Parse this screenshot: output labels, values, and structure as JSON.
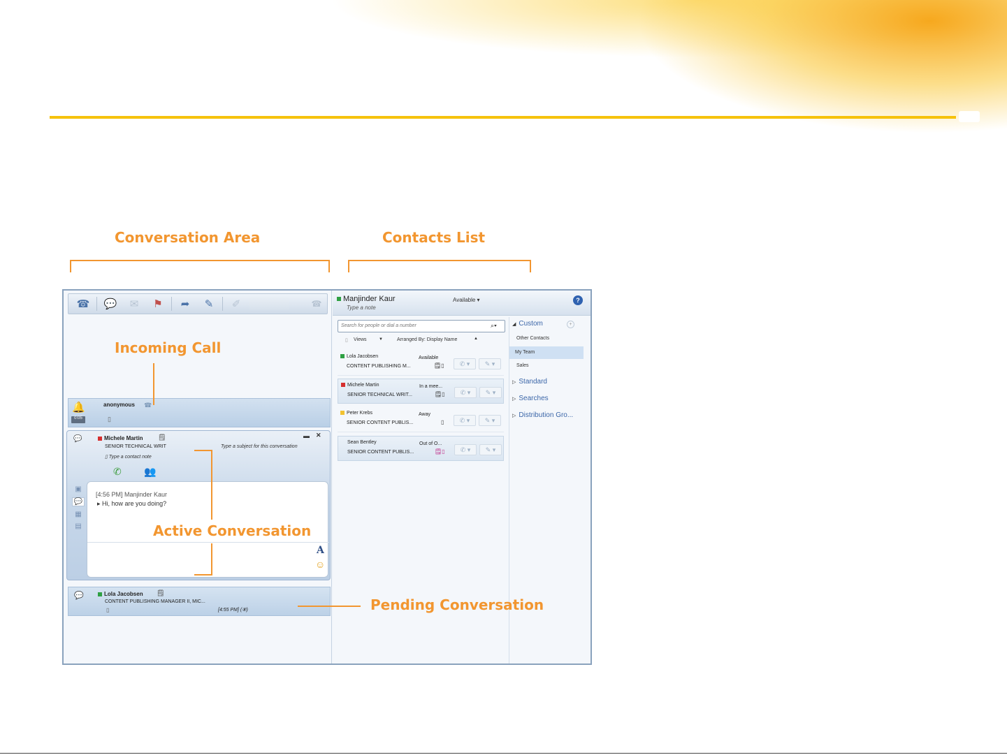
{
  "callouts": {
    "conversation_area": "Conversation Area",
    "contacts_list": "Contacts List",
    "incoming_call": "Incoming Call",
    "active_conversation": "Active Conversation",
    "pending_conversation": "Pending Conversation"
  },
  "colors": {
    "accent": "#f29630",
    "rule": "#f6c20c",
    "available": "#2ea043",
    "busy": "#d62f2f",
    "away": "#f2c230"
  },
  "icons": {
    "toolbar": [
      "phone-icon",
      "chat-icon",
      "message-icon",
      "flag-icon",
      "share-icon",
      "notes-icon",
      "tools-icon",
      "phone-small-icon"
    ],
    "incoming": "bell-icon",
    "help": "help-icon"
  },
  "conversation": {
    "incoming": {
      "caller": "anonymous",
      "badge": "0:05"
    },
    "active": {
      "name": "Michele Martin",
      "title": "SENIOR TECHNICAL WRIT",
      "subject_placeholder": "Type a subject for this conversation",
      "contact_note_placeholder": "Type a contact note",
      "messages": [
        {
          "time": "[4:56 PM] Manjinder Kaur",
          "text": "Hi, how are you doing?"
        }
      ],
      "font_glyph": "A"
    },
    "pending": {
      "name": "Lola Jacobsen",
      "title": "CONTENT PUBLISHING MANAGER II, MIC...",
      "time": "[4:55 PM] (⑧)"
    }
  },
  "contacts": {
    "me": {
      "name": "Manjinder Kaur",
      "note": "Type a note",
      "status": "Available ▾"
    },
    "search_placeholder": "Search for people or dial a number",
    "views_label": "Views",
    "arranged_label": "Arranged By: Display Name",
    "list": [
      {
        "name": "Lola Jacobsen",
        "title": "CONTENT PUBLISHING M...",
        "status": "Available",
        "presence": "available"
      },
      {
        "name": "Michele Martin",
        "title": "SENIOR TECHNICAL WRIT...",
        "status": "In a mee...",
        "presence": "busy"
      },
      {
        "name": "Peter Krebs",
        "title": "SENIOR CONTENT PUBLIS...",
        "status": "Away",
        "presence": "away"
      },
      {
        "name": "Sean Bentley",
        "title": "SENIOR CONTENT PUBLIS...",
        "status": "Out of O...",
        "presence": "offline"
      }
    ],
    "groups": {
      "custom": "Custom",
      "custom_items": [
        "Other Contacts",
        "My Team",
        "Sales"
      ],
      "standard": "Standard",
      "searches": "Searches",
      "distribution": "Distribution Gro..."
    }
  }
}
